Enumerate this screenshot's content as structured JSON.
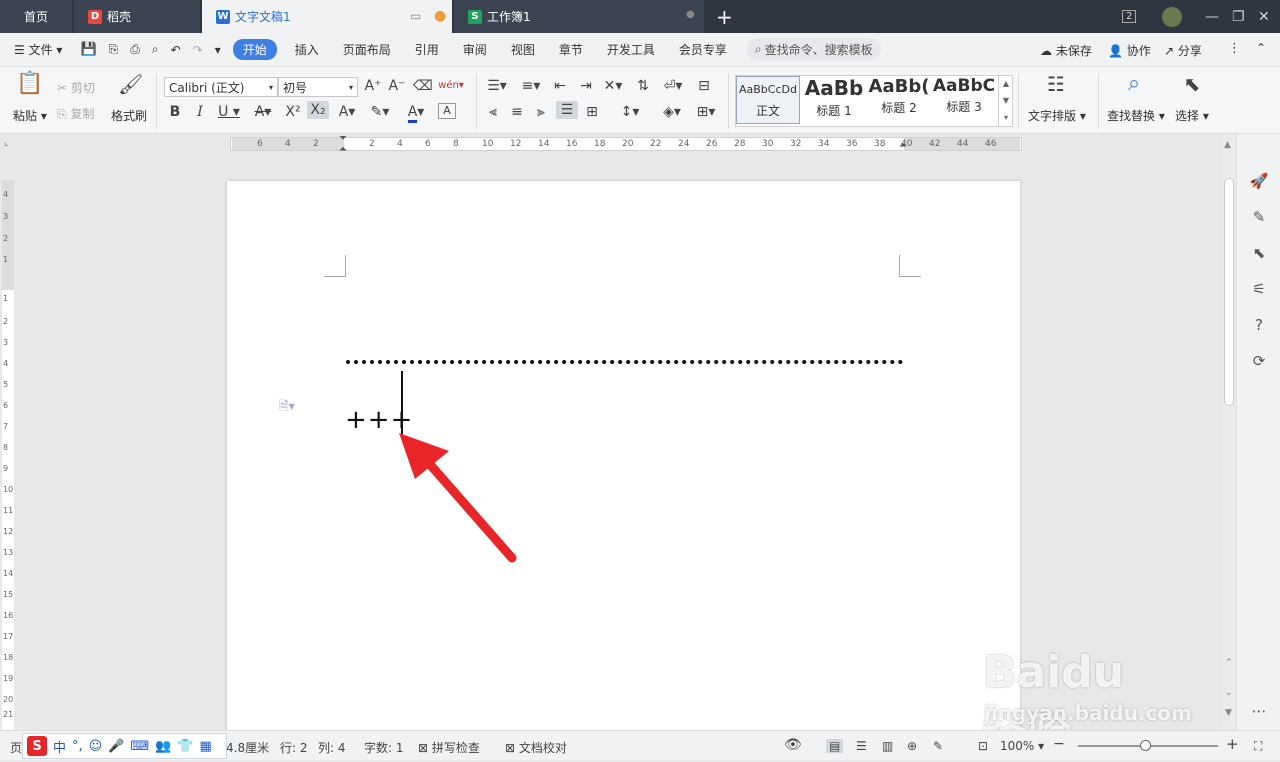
{
  "titlebar": {
    "tabs": [
      {
        "label": "首页"
      },
      {
        "label": "稻壳"
      },
      {
        "label": "文字文稿1"
      },
      {
        "label": "工作簿1"
      }
    ],
    "page_badge": "2"
  },
  "menubar": {
    "file": "文件",
    "items": [
      "开始",
      "插入",
      "页面布局",
      "引用",
      "审阅",
      "视图",
      "章节",
      "开发工具",
      "会员专享"
    ],
    "search": "查找命令、搜索模板",
    "unsaved": "未保存",
    "collab": "协作",
    "share": "分享"
  },
  "ribbon": {
    "paste": "粘贴",
    "cut": "剪切",
    "copy": "复制",
    "format_painter": "格式刷",
    "font_name": "Calibri (正文)",
    "font_size": "初号",
    "styles": [
      {
        "preview": "AaBbCcDd",
        "name": "正文"
      },
      {
        "preview": "AaBb",
        "name": "标题 1"
      },
      {
        "preview": "AaBb(",
        "name": "标题 2"
      },
      {
        "preview": "AaBbC",
        "name": "标题 3"
      }
    ],
    "text_layout": "文字排版",
    "find_replace": "查找替换",
    "select": "选择"
  },
  "ruler": {
    "h_ticks": [
      "6",
      "4",
      "2",
      "2",
      "4",
      "6",
      "8",
      "10",
      "12",
      "14",
      "16",
      "18",
      "20",
      "22",
      "24",
      "26",
      "28",
      "30",
      "32",
      "34",
      "36",
      "38",
      "40",
      "42",
      "44",
      "46"
    ],
    "v_ticks": [
      "4",
      "3",
      "2",
      "1",
      "1",
      "2",
      "3",
      "4",
      "5",
      "6",
      "7",
      "8",
      "9",
      "10",
      "11",
      "12",
      "13",
      "14",
      "15",
      "16",
      "17",
      "18",
      "19",
      "20",
      "21"
    ]
  },
  "document": {
    "text": "+++"
  },
  "statusbar": {
    "position": "4.8厘米",
    "row": "行: 2",
    "col": "列: 4",
    "word_count": "字数: 1",
    "spell_check": "拼写检查",
    "doc_proof": "文档校对",
    "zoom": "100%"
  },
  "ime": {
    "mode": "中"
  },
  "watermark": {
    "brand": "Baidu经验",
    "url": "jingyan.baidu.com"
  },
  "colors": {
    "accent": "#3f7fe4",
    "arrow": "#e8262a",
    "titlebar": "#2f3641"
  }
}
